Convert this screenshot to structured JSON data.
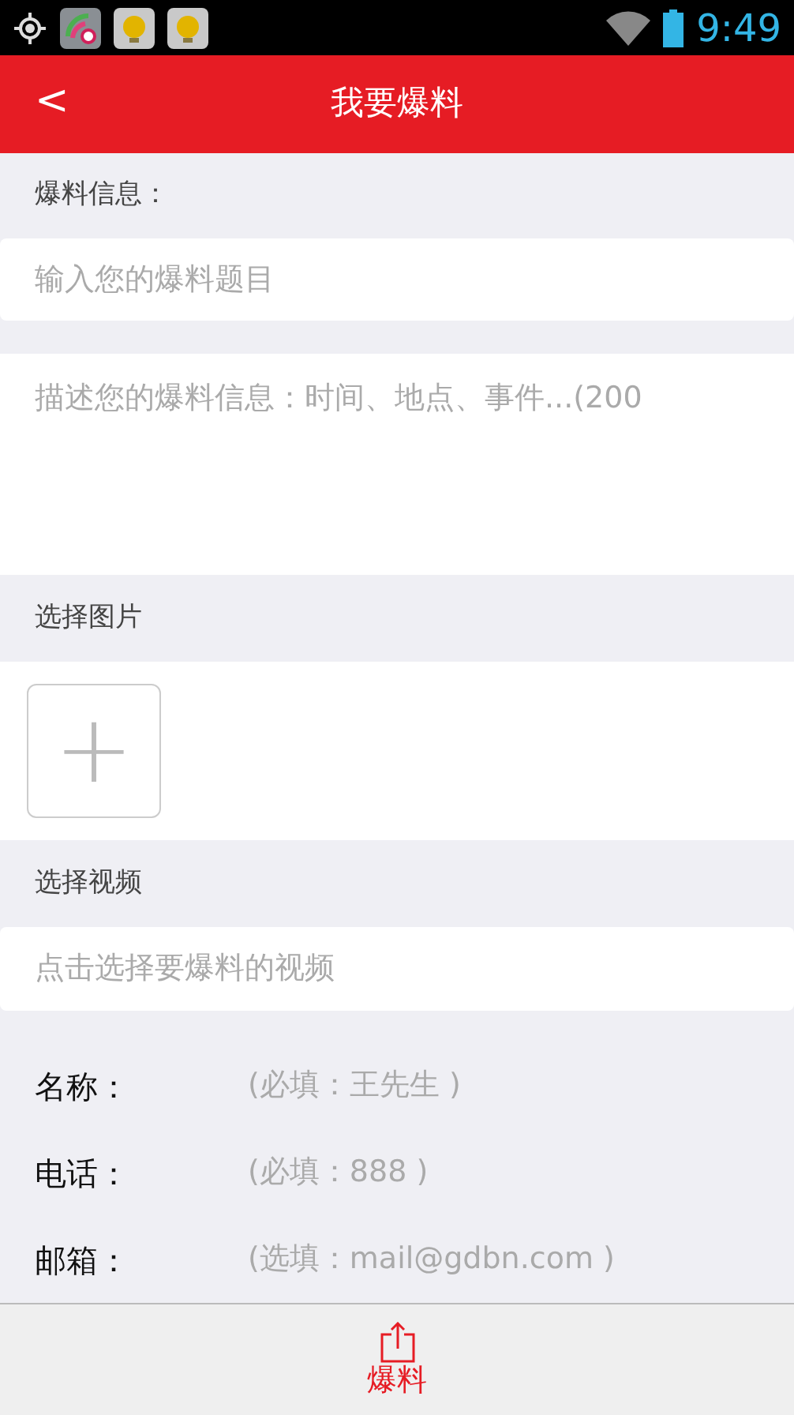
{
  "status_bar": {
    "time": "9:49"
  },
  "header": {
    "back": "<",
    "title": "我要爆料"
  },
  "info_section": {
    "label": "爆料信息：",
    "title_field": {
      "placeholder": "输入您的爆料题目"
    },
    "description_field": {
      "placeholder": "描述您的爆料信息：时间、地点、事件...(200"
    }
  },
  "image_section": {
    "label": "选择图片",
    "add": "+"
  },
  "video_section": {
    "label": "选择视频",
    "field": {
      "placeholder": "点击选择要爆料的视频"
    }
  },
  "contact_fields": [
    {
      "label": "名称：",
      "placeholder": "(必填：王先生 )"
    },
    {
      "label": "电话：",
      "placeholder": "(必填：888 )"
    },
    {
      "label": "邮箱：",
      "placeholder": "(选填：mail@gdbn.com )"
    }
  ],
  "bottom_bar": {
    "label": "爆料"
  }
}
